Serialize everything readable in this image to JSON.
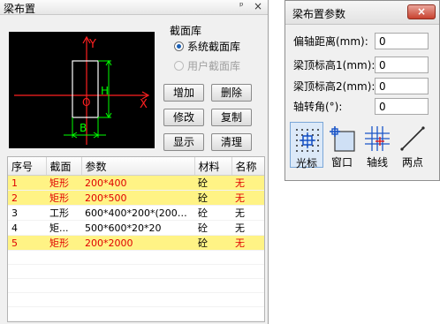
{
  "left_panel": {
    "title": "梁布置",
    "pin_glyph": "ᵖ",
    "close_glyph": "×",
    "preview": {
      "axis_y_label": "Y",
      "axis_x_label": "X",
      "origin_label": "O",
      "height_label": "H",
      "width_label": "B",
      "colors": {
        "axis": "#ff2020",
        "dimension": "#00ff00",
        "shape": "#ffffff"
      }
    },
    "section_library": {
      "label": "截面库",
      "options": [
        {
          "label": "系统截面库",
          "selected": true,
          "enabled": true
        },
        {
          "label": "用户截面库",
          "selected": false,
          "enabled": false
        }
      ]
    },
    "buttons": {
      "add": "增加",
      "delete": "删除",
      "modify": "修改",
      "copy": "复制",
      "show": "显示",
      "clean": "清理"
    },
    "table": {
      "headers": [
        "序号",
        "截面",
        "参数",
        "材料",
        "名称"
      ],
      "rows": [
        {
          "no": "1",
          "section": "矩形",
          "params": "200*400",
          "material": "砼",
          "name": "无",
          "highlight": true
        },
        {
          "no": "2",
          "section": "矩形",
          "params": "200*500",
          "material": "砼",
          "name": "无",
          "highlight": true
        },
        {
          "no": "3",
          "section": "工形",
          "params": "600*400*200*(200~...",
          "material": "砼",
          "name": "无",
          "highlight": false
        },
        {
          "no": "4",
          "section": "矩...",
          "params": "500*600*20*20",
          "material": "砼",
          "name": "无",
          "highlight": false
        },
        {
          "no": "5",
          "section": "矩形",
          "params": "200*2000",
          "material": "砼",
          "name": "无",
          "highlight": true
        }
      ],
      "highlight_color": "#fff385",
      "highlight_text_color": "#e00000"
    }
  },
  "right_panel": {
    "title": "梁布置参数",
    "close_glyph": "×",
    "params": [
      {
        "label": "偏轴距离(mm):",
        "value": "0"
      },
      {
        "label": "梁顶标高1(mm):",
        "value": "0"
      },
      {
        "label": "梁顶标高2(mm):",
        "value": "0"
      },
      {
        "label": "轴转角(°):",
        "value": "0"
      }
    ],
    "tools": [
      {
        "label": "光标",
        "icon": "cursor-grid-icon",
        "selected": true
      },
      {
        "label": "窗口",
        "icon": "window-select-icon",
        "selected": false
      },
      {
        "label": "轴线",
        "icon": "axis-grid-icon",
        "selected": false
      },
      {
        "label": "两点",
        "icon": "two-point-line-icon",
        "selected": false
      }
    ]
  }
}
